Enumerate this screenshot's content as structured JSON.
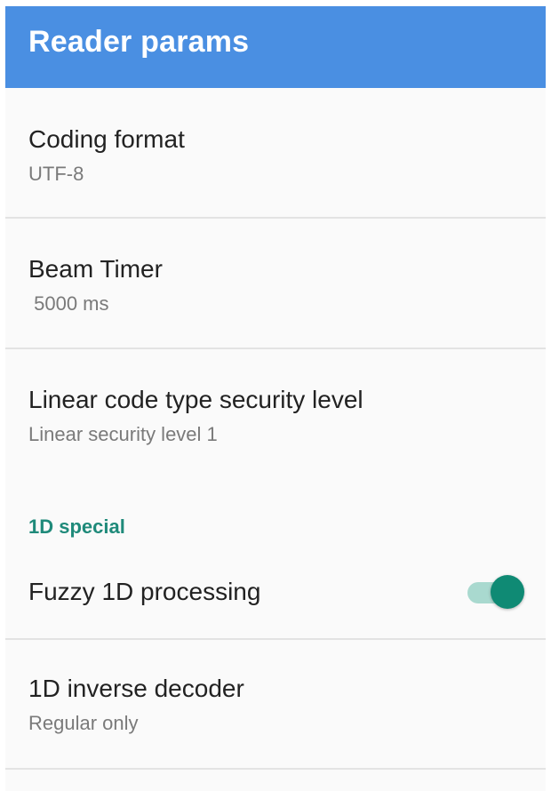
{
  "toolbar": {
    "title": "Reader params",
    "color": "#4a8fe2"
  },
  "prefs": {
    "coding_format": {
      "title": "Coding format",
      "summary": "UTF-8"
    },
    "beam_timer": {
      "title": "Beam Timer",
      "summary": " 5000 ms"
    },
    "linear_security": {
      "title": "Linear code type security level",
      "summary": "Linear security level 1"
    },
    "category_1d_special": {
      "label": "1D special",
      "color": "#1f8a7a"
    },
    "fuzzy_1d": {
      "title": "Fuzzy 1D processing",
      "enabled": true,
      "switch_color": "#0f8a74"
    },
    "inverse_decoder": {
      "title": "1D inverse decoder",
      "summary": "Regular only"
    }
  }
}
